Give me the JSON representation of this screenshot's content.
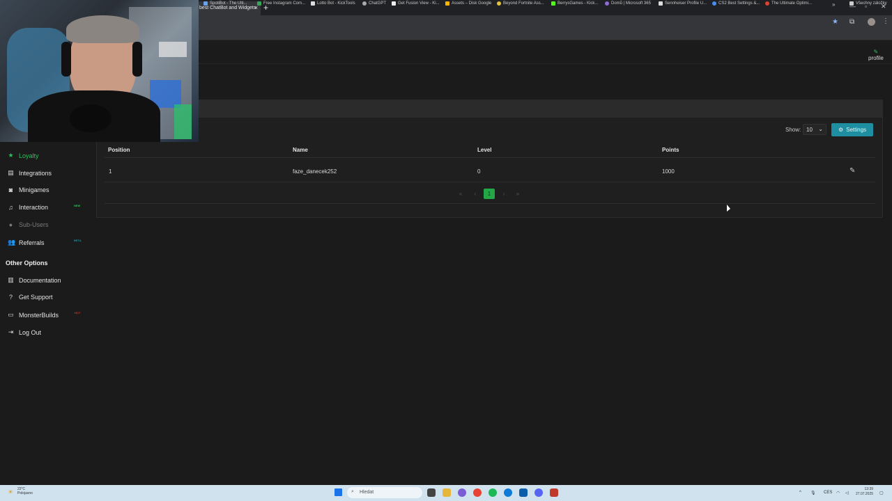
{
  "browser": {
    "tab_title": "best ChatBot and Widgets",
    "tab_close": "×",
    "new_tab": "+",
    "bookmarks": [
      "SpotiBot - The Ulti...",
      "Free Instagram Com...",
      "Lotto Bot - KickTools",
      "ChatGPT",
      "Get Fusion View - Ki...",
      "Assets – Disk Google",
      "Beyond Fortnite Ass...",
      "BerrysGames - Kick...",
      "Domů | Microsoft 365",
      "Sennheiser Profile U...",
      "CS2 Best Settings &...",
      "The Ultimate Optimi..."
    ],
    "bookmarks_overflow": "»",
    "all_bookmarks": "Všechny záložky"
  },
  "header": {
    "profile_label": "profile"
  },
  "table": {
    "show_label": "Show:",
    "show_value": "10",
    "settings_label": "Settings",
    "columns": [
      "Position",
      "Name",
      "Level",
      "Points"
    ],
    "rows": [
      {
        "position": "1",
        "name": "faze_danecek252",
        "level": "0",
        "points": "1000"
      }
    ],
    "pagination": {
      "first": "«",
      "prev": "‹",
      "current": "1",
      "next": "›",
      "last": "»"
    }
  },
  "sidebar": {
    "items": [
      {
        "label": "Loyalty",
        "icon": "star-icon"
      },
      {
        "label": "Integrations",
        "icon": "plug-icon"
      },
      {
        "label": "Minigames",
        "icon": "gamepad-icon"
      },
      {
        "label": "Interaction",
        "icon": "music-icon",
        "badge": "NEW"
      },
      {
        "label": "Sub-Users",
        "icon": "users-icon"
      },
      {
        "label": "Referrals",
        "icon": "users-icon",
        "badge": "BETA"
      }
    ],
    "other_options_title": "Other Options",
    "other_items": [
      {
        "label": "Documentation",
        "icon": "book-icon"
      },
      {
        "label": "Get Support",
        "icon": "question-icon"
      },
      {
        "label": "MonsterBuilds",
        "icon": "monitor-icon",
        "badge": "HOT"
      },
      {
        "label": "Log Out",
        "icon": "logout-icon"
      }
    ]
  },
  "taskbar": {
    "weather_temp": "22°C",
    "weather_desc": "Polojasno",
    "search_placeholder": "Hledat",
    "lang": "CES",
    "time": "13:39",
    "date": "27.07.2025"
  },
  "colors": {
    "accent_green": "#2ec05c",
    "settings_teal": "#1d8fa0",
    "page_active": "#22a646"
  }
}
